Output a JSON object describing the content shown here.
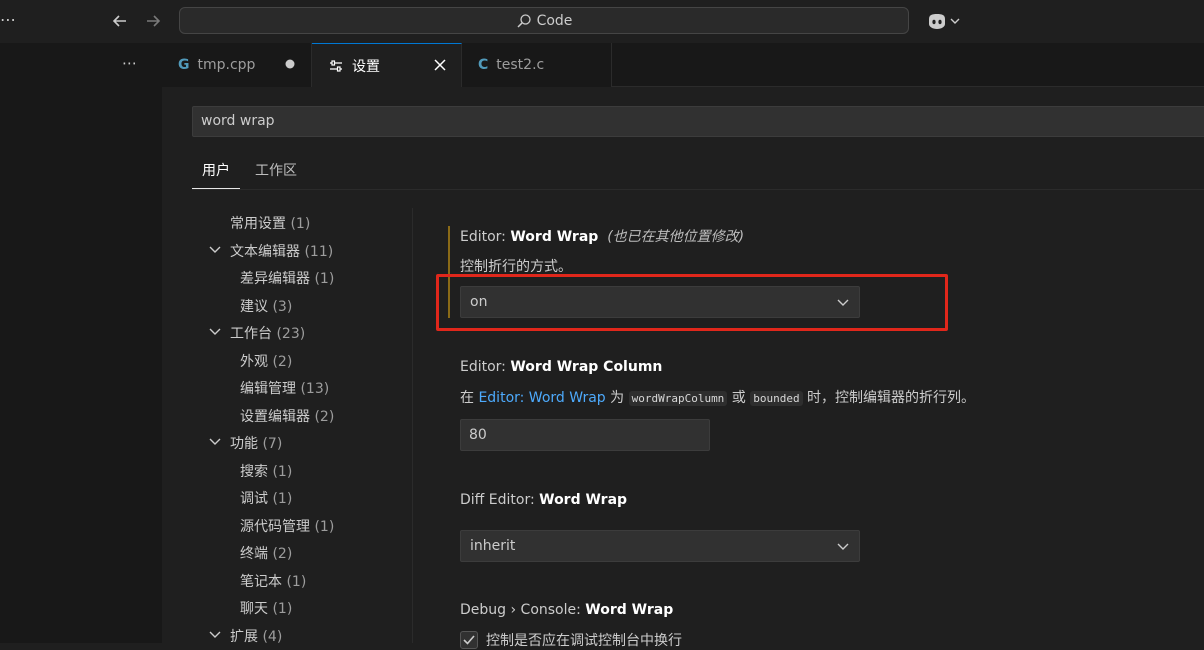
{
  "titlebar": {
    "search_text": "Code"
  },
  "tabs": [
    {
      "label": "tmp.cpp",
      "icon": "cpp-file-icon",
      "icon_glyph": "G",
      "icon_color": "#519aba",
      "modified": true
    },
    {
      "label": "设置",
      "icon": "settings-sliders-icon",
      "active": true
    },
    {
      "label": "test2.c",
      "icon": "c-file-icon",
      "icon_glyph": "C",
      "icon_color": "#519aba"
    }
  ],
  "settings_search": {
    "value": "word wrap"
  },
  "scopes": [
    {
      "label": "用户",
      "active": true
    },
    {
      "label": "工作区"
    }
  ],
  "toc": [
    {
      "label": "常用设置",
      "count": "(1)",
      "level": 1,
      "expanded": null
    },
    {
      "label": "文本编辑器",
      "count": "(11)",
      "level": 0,
      "expanded": true
    },
    {
      "label": "差异编辑器",
      "count": "(1)",
      "level": 1
    },
    {
      "label": "建议",
      "count": "(3)",
      "level": 1
    },
    {
      "label": "工作台",
      "count": "(23)",
      "level": 0,
      "expanded": true
    },
    {
      "label": "外观",
      "count": "(2)",
      "level": 1
    },
    {
      "label": "编辑管理",
      "count": "(13)",
      "level": 1
    },
    {
      "label": "设置编辑器",
      "count": "(2)",
      "level": 1
    },
    {
      "label": "功能",
      "count": "(7)",
      "level": 0,
      "expanded": true
    },
    {
      "label": "搜索",
      "count": "(1)",
      "level": 1
    },
    {
      "label": "调试",
      "count": "(1)",
      "level": 1
    },
    {
      "label": "源代码管理",
      "count": "(1)",
      "level": 1
    },
    {
      "label": "终端",
      "count": "(2)",
      "level": 1
    },
    {
      "label": "笔记本",
      "count": "(1)",
      "level": 1
    },
    {
      "label": "聊天",
      "count": "(1)",
      "level": 1
    },
    {
      "label": "扩展",
      "count": "(4)",
      "level": 0,
      "expanded": true
    }
  ],
  "settings": {
    "word_wrap": {
      "category": "Editor: ",
      "name": "Word Wrap",
      "note": "(也已在其他位置修改)",
      "description": "控制折行的方式。",
      "value": "on"
    },
    "word_wrap_column": {
      "category": "Editor: ",
      "name": "Word Wrap Column",
      "desc_prefix": "在 ",
      "desc_link": "Editor: Word Wrap",
      "desc_mid1": " 为 ",
      "desc_code1": "wordWrapColumn",
      "desc_mid2": " 或 ",
      "desc_code2": "bounded",
      "desc_suffix": " 时，控制编辑器的折行列。",
      "value": "80"
    },
    "diff_word_wrap": {
      "category": "Diff Editor: ",
      "name": "Word Wrap",
      "value": "inherit"
    },
    "debug_console_word_wrap": {
      "category": "Debug › Console: ",
      "name": "Word Wrap",
      "description": "控制是否应在调试控制台中换行",
      "checked": true
    }
  },
  "colors": {
    "accent": "#0078d4",
    "highlight": "#e0271b",
    "modified": "#8a6a17",
    "link": "#4daafc"
  }
}
